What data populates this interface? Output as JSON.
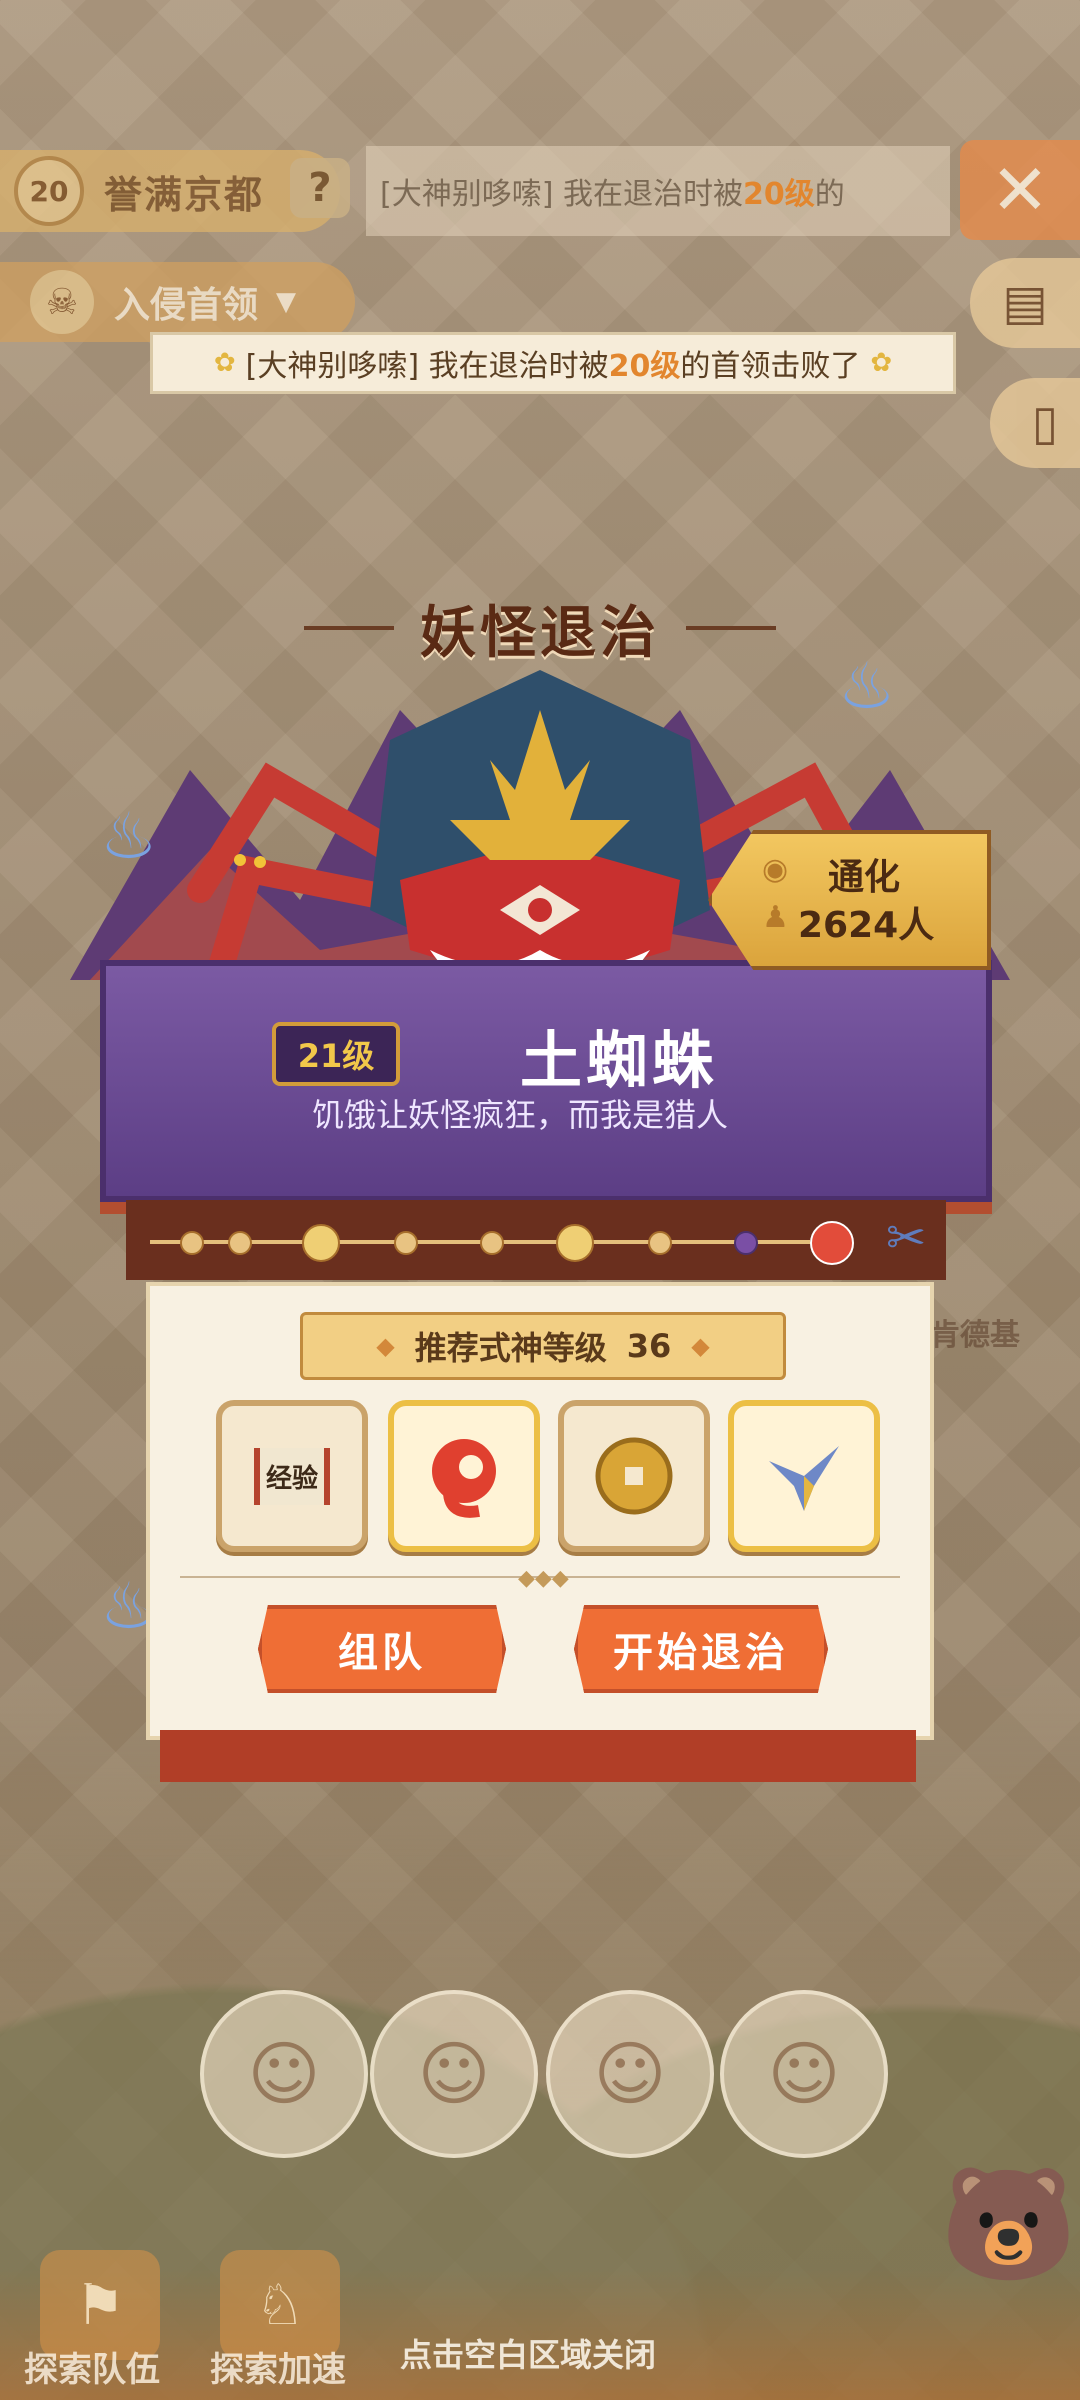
{
  "header": {
    "level": "20",
    "city_name": "誉满京都",
    "help_icon": "question-icon",
    "ticker_prefix": "[大神别哆嗦] 我在退治时被",
    "ticker_level": "20级",
    "ticker_suffix": "的",
    "close_icon": "close-icon"
  },
  "boss_filter": {
    "label": "入侵首领"
  },
  "announcement": {
    "prefix": "[大神别哆嗦] 我在退治时被",
    "highlight": "20级",
    "suffix": "的首领击败了"
  },
  "card": {
    "title": "妖怪退治",
    "boss_level": "21级",
    "boss_name": "土蜘蛛",
    "boss_quote": "饥饿让妖怪疯狂，而我是猎人",
    "location": {
      "city": "通化",
      "count": "2624人"
    },
    "recommend_label": "推荐式神等级",
    "recommend_value": "36",
    "rewards": [
      {
        "label": "经验",
        "icon": "exp-scroll-icon"
      },
      {
        "label": "",
        "icon": "red-magatama-icon"
      },
      {
        "label": "",
        "icon": "gold-coin-icon"
      },
      {
        "label": "",
        "icon": "paper-crane-icon"
      }
    ],
    "team_button": "组队",
    "start_button": "开始退治"
  },
  "background_labels": {
    "shop_label": "肯德基"
  },
  "bottom": {
    "team_label": "探索队伍",
    "speed_label": "探索加速",
    "close_hint": "点击空白区域关闭"
  },
  "colors": {
    "accent_orange": "#ef6e35",
    "banner_purple": "#6b4a94",
    "highlight": "#e2862e"
  }
}
